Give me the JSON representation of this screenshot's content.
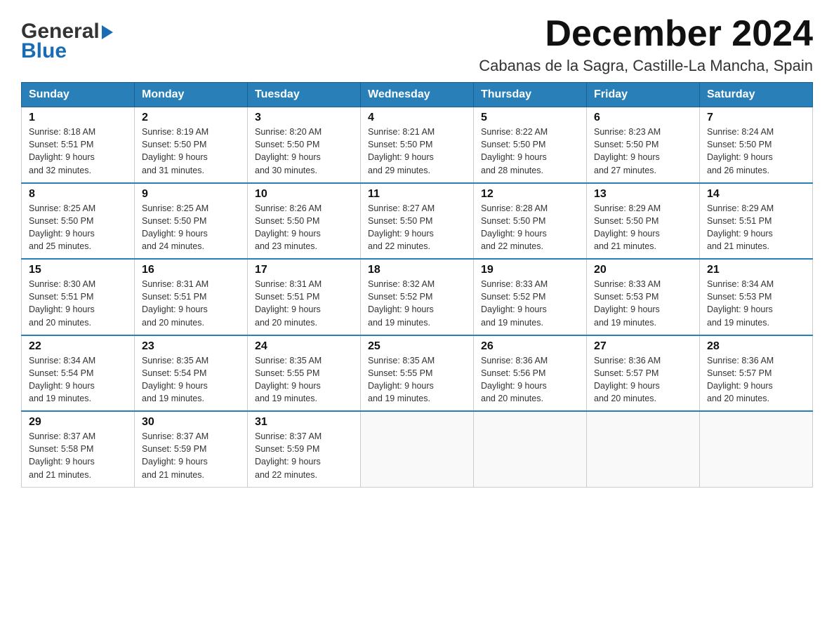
{
  "header": {
    "logo_general": "General",
    "logo_blue": "Blue",
    "month_year": "December 2024",
    "location": "Cabanas de la Sagra, Castille-La Mancha, Spain"
  },
  "days_of_week": [
    "Sunday",
    "Monday",
    "Tuesday",
    "Wednesday",
    "Thursday",
    "Friday",
    "Saturday"
  ],
  "weeks": [
    [
      {
        "day": "1",
        "sunrise": "Sunrise: 8:18 AM",
        "sunset": "Sunset: 5:51 PM",
        "daylight": "Daylight: 9 hours",
        "minutes": "and 32 minutes."
      },
      {
        "day": "2",
        "sunrise": "Sunrise: 8:19 AM",
        "sunset": "Sunset: 5:50 PM",
        "daylight": "Daylight: 9 hours",
        "minutes": "and 31 minutes."
      },
      {
        "day": "3",
        "sunrise": "Sunrise: 8:20 AM",
        "sunset": "Sunset: 5:50 PM",
        "daylight": "Daylight: 9 hours",
        "minutes": "and 30 minutes."
      },
      {
        "day": "4",
        "sunrise": "Sunrise: 8:21 AM",
        "sunset": "Sunset: 5:50 PM",
        "daylight": "Daylight: 9 hours",
        "minutes": "and 29 minutes."
      },
      {
        "day": "5",
        "sunrise": "Sunrise: 8:22 AM",
        "sunset": "Sunset: 5:50 PM",
        "daylight": "Daylight: 9 hours",
        "minutes": "and 28 minutes."
      },
      {
        "day": "6",
        "sunrise": "Sunrise: 8:23 AM",
        "sunset": "Sunset: 5:50 PM",
        "daylight": "Daylight: 9 hours",
        "minutes": "and 27 minutes."
      },
      {
        "day": "7",
        "sunrise": "Sunrise: 8:24 AM",
        "sunset": "Sunset: 5:50 PM",
        "daylight": "Daylight: 9 hours",
        "minutes": "and 26 minutes."
      }
    ],
    [
      {
        "day": "8",
        "sunrise": "Sunrise: 8:25 AM",
        "sunset": "Sunset: 5:50 PM",
        "daylight": "Daylight: 9 hours",
        "minutes": "and 25 minutes."
      },
      {
        "day": "9",
        "sunrise": "Sunrise: 8:25 AM",
        "sunset": "Sunset: 5:50 PM",
        "daylight": "Daylight: 9 hours",
        "minutes": "and 24 minutes."
      },
      {
        "day": "10",
        "sunrise": "Sunrise: 8:26 AM",
        "sunset": "Sunset: 5:50 PM",
        "daylight": "Daylight: 9 hours",
        "minutes": "and 23 minutes."
      },
      {
        "day": "11",
        "sunrise": "Sunrise: 8:27 AM",
        "sunset": "Sunset: 5:50 PM",
        "daylight": "Daylight: 9 hours",
        "minutes": "and 22 minutes."
      },
      {
        "day": "12",
        "sunrise": "Sunrise: 8:28 AM",
        "sunset": "Sunset: 5:50 PM",
        "daylight": "Daylight: 9 hours",
        "minutes": "and 22 minutes."
      },
      {
        "day": "13",
        "sunrise": "Sunrise: 8:29 AM",
        "sunset": "Sunset: 5:50 PM",
        "daylight": "Daylight: 9 hours",
        "minutes": "and 21 minutes."
      },
      {
        "day": "14",
        "sunrise": "Sunrise: 8:29 AM",
        "sunset": "Sunset: 5:51 PM",
        "daylight": "Daylight: 9 hours",
        "minutes": "and 21 minutes."
      }
    ],
    [
      {
        "day": "15",
        "sunrise": "Sunrise: 8:30 AM",
        "sunset": "Sunset: 5:51 PM",
        "daylight": "Daylight: 9 hours",
        "minutes": "and 20 minutes."
      },
      {
        "day": "16",
        "sunrise": "Sunrise: 8:31 AM",
        "sunset": "Sunset: 5:51 PM",
        "daylight": "Daylight: 9 hours",
        "minutes": "and 20 minutes."
      },
      {
        "day": "17",
        "sunrise": "Sunrise: 8:31 AM",
        "sunset": "Sunset: 5:51 PM",
        "daylight": "Daylight: 9 hours",
        "minutes": "and 20 minutes."
      },
      {
        "day": "18",
        "sunrise": "Sunrise: 8:32 AM",
        "sunset": "Sunset: 5:52 PM",
        "daylight": "Daylight: 9 hours",
        "minutes": "and 19 minutes."
      },
      {
        "day": "19",
        "sunrise": "Sunrise: 8:33 AM",
        "sunset": "Sunset: 5:52 PM",
        "daylight": "Daylight: 9 hours",
        "minutes": "and 19 minutes."
      },
      {
        "day": "20",
        "sunrise": "Sunrise: 8:33 AM",
        "sunset": "Sunset: 5:53 PM",
        "daylight": "Daylight: 9 hours",
        "minutes": "and 19 minutes."
      },
      {
        "day": "21",
        "sunrise": "Sunrise: 8:34 AM",
        "sunset": "Sunset: 5:53 PM",
        "daylight": "Daylight: 9 hours",
        "minutes": "and 19 minutes."
      }
    ],
    [
      {
        "day": "22",
        "sunrise": "Sunrise: 8:34 AM",
        "sunset": "Sunset: 5:54 PM",
        "daylight": "Daylight: 9 hours",
        "minutes": "and 19 minutes."
      },
      {
        "day": "23",
        "sunrise": "Sunrise: 8:35 AM",
        "sunset": "Sunset: 5:54 PM",
        "daylight": "Daylight: 9 hours",
        "minutes": "and 19 minutes."
      },
      {
        "day": "24",
        "sunrise": "Sunrise: 8:35 AM",
        "sunset": "Sunset: 5:55 PM",
        "daylight": "Daylight: 9 hours",
        "minutes": "and 19 minutes."
      },
      {
        "day": "25",
        "sunrise": "Sunrise: 8:35 AM",
        "sunset": "Sunset: 5:55 PM",
        "daylight": "Daylight: 9 hours",
        "minutes": "and 19 minutes."
      },
      {
        "day": "26",
        "sunrise": "Sunrise: 8:36 AM",
        "sunset": "Sunset: 5:56 PM",
        "daylight": "Daylight: 9 hours",
        "minutes": "and 20 minutes."
      },
      {
        "day": "27",
        "sunrise": "Sunrise: 8:36 AM",
        "sunset": "Sunset: 5:57 PM",
        "daylight": "Daylight: 9 hours",
        "minutes": "and 20 minutes."
      },
      {
        "day": "28",
        "sunrise": "Sunrise: 8:36 AM",
        "sunset": "Sunset: 5:57 PM",
        "daylight": "Daylight: 9 hours",
        "minutes": "and 20 minutes."
      }
    ],
    [
      {
        "day": "29",
        "sunrise": "Sunrise: 8:37 AM",
        "sunset": "Sunset: 5:58 PM",
        "daylight": "Daylight: 9 hours",
        "minutes": "and 21 minutes."
      },
      {
        "day": "30",
        "sunrise": "Sunrise: 8:37 AM",
        "sunset": "Sunset: 5:59 PM",
        "daylight": "Daylight: 9 hours",
        "minutes": "and 21 minutes."
      },
      {
        "day": "31",
        "sunrise": "Sunrise: 8:37 AM",
        "sunset": "Sunset: 5:59 PM",
        "daylight": "Daylight: 9 hours",
        "minutes": "and 22 minutes."
      },
      null,
      null,
      null,
      null
    ]
  ]
}
